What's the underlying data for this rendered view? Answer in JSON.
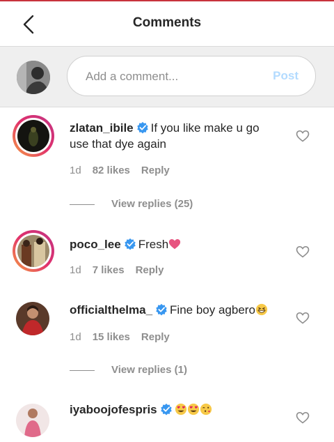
{
  "header": {
    "title": "Comments"
  },
  "compose": {
    "placeholder": "Add a comment...",
    "post_label": "Post"
  },
  "comments": [
    {
      "username": "zlatan_ibile",
      "text": "If you like make u go use that dye again",
      "time": "1d",
      "likes": "82 likes",
      "reply": "Reply",
      "view_replies": "View replies (25)"
    },
    {
      "username": "poco_lee",
      "text": "Fresh",
      "time": "1d",
      "likes": "7 likes",
      "reply": "Reply"
    },
    {
      "username": "officialthelma_",
      "text": "Fine boy agbero",
      "time": "1d",
      "likes": "15 likes",
      "reply": "Reply",
      "view_replies": "View replies (1)"
    },
    {
      "username": "iyaboojofespris",
      "text": ""
    }
  ],
  "colors": {
    "verified": "#3897f0",
    "post_disabled": "#b3dbff",
    "heart_emoji": "#e75480"
  },
  "icons": {
    "back": "chevron-left-icon",
    "like": "heart-outline-icon",
    "verified": "verified-badge-icon"
  }
}
